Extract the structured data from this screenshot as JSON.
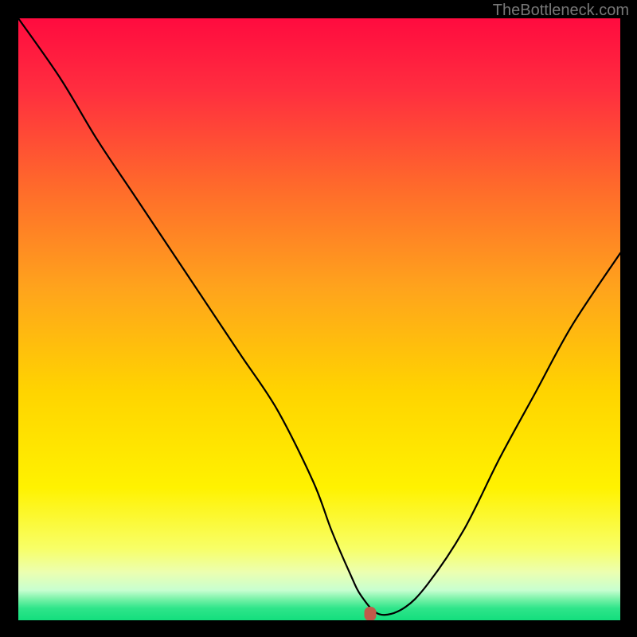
{
  "watermark": "TheBottleneck.com",
  "chart_data": {
    "type": "line",
    "title": "",
    "xlabel": "",
    "ylabel": "",
    "xlim": [
      0,
      100
    ],
    "ylim": [
      0,
      100
    ],
    "x": [
      0,
      7,
      13,
      19,
      25,
      31,
      37,
      43,
      49,
      52,
      55,
      57,
      60,
      64,
      68,
      74,
      80,
      86,
      92,
      100
    ],
    "values": [
      100,
      90,
      80,
      71,
      62,
      53,
      44,
      35,
      23,
      15,
      8,
      4,
      1,
      2,
      6,
      15,
      27,
      38,
      49,
      61
    ],
    "marker": {
      "x": 58.5,
      "y": 1.0,
      "color": "#c05a4a"
    },
    "gradient_stops": [
      {
        "pos": 0.0,
        "color": "#ff0b3f"
      },
      {
        "pos": 0.12,
        "color": "#ff2e3f"
      },
      {
        "pos": 0.28,
        "color": "#ff6a2b"
      },
      {
        "pos": 0.45,
        "color": "#ffa41c"
      },
      {
        "pos": 0.62,
        "color": "#ffd400"
      },
      {
        "pos": 0.78,
        "color": "#fff200"
      },
      {
        "pos": 0.88,
        "color": "#f8ff66"
      },
      {
        "pos": 0.92,
        "color": "#ecffb0"
      },
      {
        "pos": 0.95,
        "color": "#c8ffd0"
      },
      {
        "pos": 0.965,
        "color": "#77f2a8"
      },
      {
        "pos": 0.98,
        "color": "#2fe58a"
      },
      {
        "pos": 1.0,
        "color": "#13de7d"
      }
    ]
  }
}
